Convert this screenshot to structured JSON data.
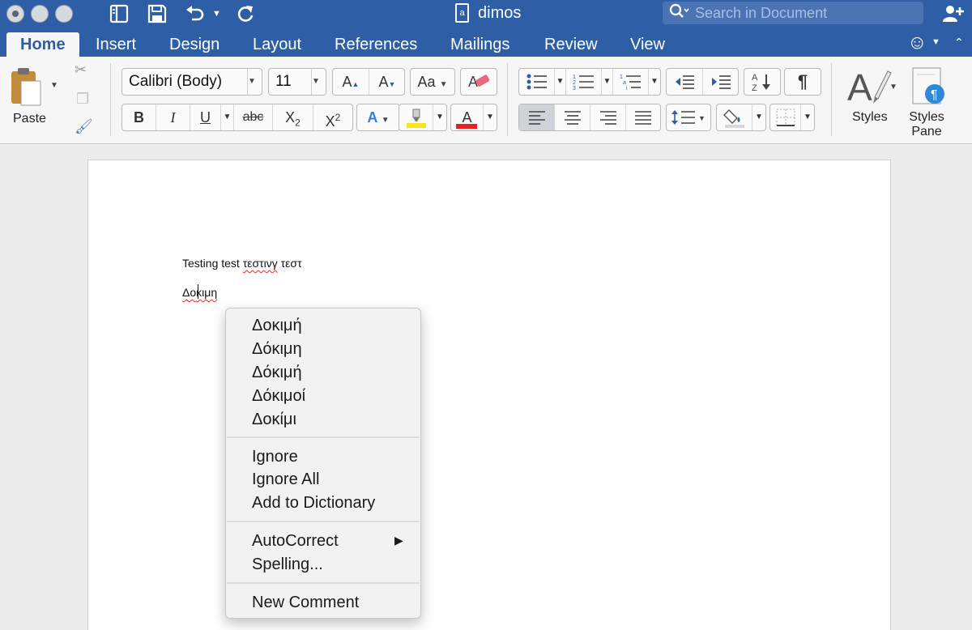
{
  "window": {
    "title": "dimos",
    "search_placeholder": "Search in Document"
  },
  "tabs": [
    "Home",
    "Insert",
    "Design",
    "Layout",
    "References",
    "Mailings",
    "Review",
    "View"
  ],
  "ribbon": {
    "paste_label": "Paste",
    "font_name": "Calibri (Body)",
    "font_size": "11",
    "grow_font": "A",
    "shrink_font": "A",
    "change_case": "Aa",
    "bold": "B",
    "italic": "I",
    "underline": "U",
    "strikethrough": "abc",
    "subscript": "X",
    "subscript_mark": "2",
    "superscript": "X",
    "superscript_mark": "2",
    "text_effects": "A",
    "font_color": "A",
    "show_marks": "¶",
    "styles_label": "Styles",
    "styles_pane_label": "Styles Pane",
    "highlight_color": "#f5e616",
    "font_color_value": "#e8201f",
    "accent_color": "#2e5fa6"
  },
  "document": {
    "line1_plain": "Testing test ",
    "line1_misspelled": "τεστινγ",
    "line1_tail": " τεστ",
    "line2_pre": "Δο",
    "line2_post": "κιμη"
  },
  "context_menu": {
    "suggestions": [
      "Δοκιμή",
      "Δόκιμη",
      "Δόκιμή",
      "Δόκιμοί",
      "Δοκίμι"
    ],
    "ignore": "Ignore",
    "ignore_all": "Ignore All",
    "add_to_dictionary": "Add to Dictionary",
    "autocorrect": "AutoCorrect",
    "spelling": "Spelling...",
    "new_comment": "New Comment"
  }
}
